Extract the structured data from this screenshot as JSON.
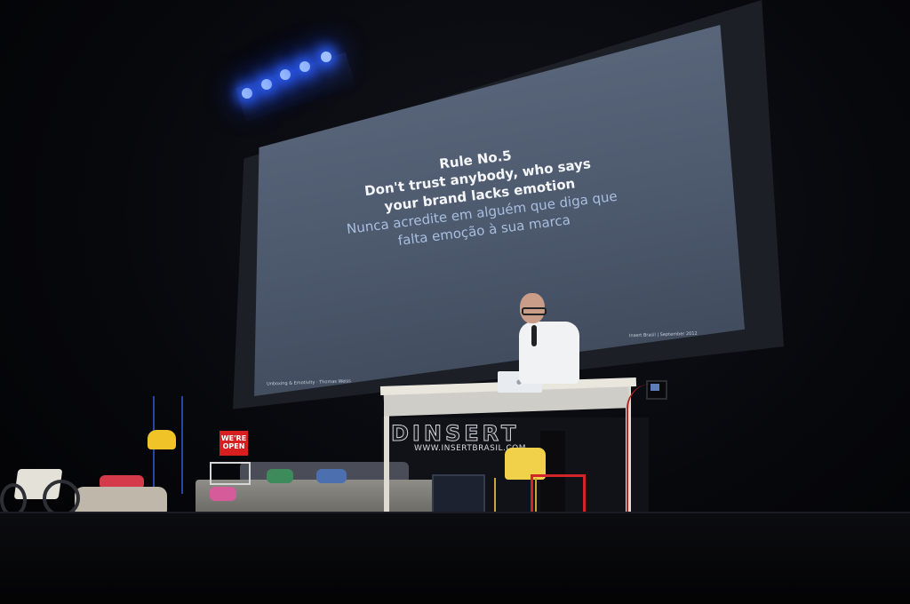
{
  "slide": {
    "line1": "Rule No.5",
    "line2": "Don't trust anybody, who says",
    "line3": "your brand lacks emotion",
    "line4": "Nunca acredite em alguém que diga que",
    "line5": "falta emoção à sua marca",
    "footer_left": "Unboxing & Emotivity · Thomas Weiss",
    "footer_right": "Insert Brasil | September 2012"
  },
  "stage_props": {
    "banner_text": "DINSERT",
    "banner_url": "WWW.INSERTBRASIL.COM",
    "open_sign_line1": "WE'RE",
    "open_sign_line2": "OPEN"
  },
  "colors": {
    "screen": "#5a667b",
    "spotlight": "#2e62ff",
    "open_sign": "#d81f1f",
    "chair": "#f2d14a"
  }
}
